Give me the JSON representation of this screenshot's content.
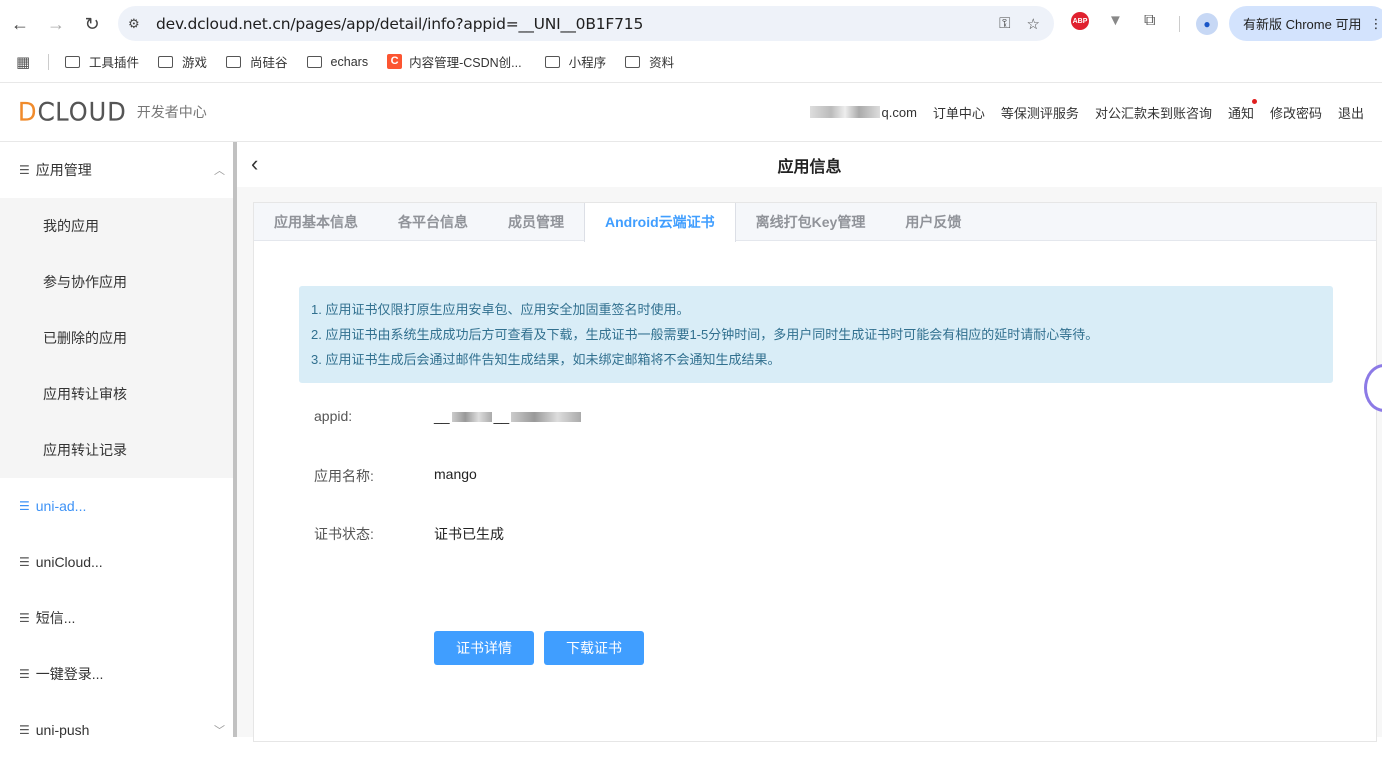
{
  "browser": {
    "url": "dev.dcloud.net.cn/pages/app/detail/info?appid=__UNI__0B1F715",
    "update_label": "有新版 Chrome 可用",
    "bookmarks": [
      {
        "label": "工具插件",
        "type": "folder"
      },
      {
        "label": "游戏",
        "type": "folder"
      },
      {
        "label": "尚硅谷",
        "type": "folder"
      },
      {
        "label": "echars",
        "type": "folder"
      },
      {
        "label": "内容管理-CSDN创...",
        "type": "csdn"
      },
      {
        "label": "小程序",
        "type": "folder"
      },
      {
        "label": "资料",
        "type": "folder"
      }
    ]
  },
  "header": {
    "logo_text": "DCLOUD",
    "subtitle": "开发者中心",
    "email_suffix": "q.com",
    "links": [
      "订单中心",
      "等保测评服务",
      "对公汇款未到账咨询",
      "通知",
      "修改密码",
      "退出"
    ]
  },
  "sidebar": {
    "group_app": "应用管理",
    "sub_items": [
      "我的应用",
      "参与协作应用",
      "已删除的应用",
      "应用转让审核",
      "应用转让记录"
    ],
    "groups": [
      "uni-ad...",
      "uniCloud...",
      "短信...",
      "一键登录...",
      "uni-push"
    ]
  },
  "main": {
    "title": "应用信息",
    "tabs": [
      "应用基本信息",
      "各平台信息",
      "成员管理",
      "Android云端证书",
      "离线打包Key管理",
      "用户反馈"
    ],
    "notices": [
      "1. 应用证书仅限打原生应用安卓包、应用安全加固重签名时使用。",
      "2. 应用证书由系统生成成功后方可查看及下载，生成证书一般需要1-5分钟时间，多用户同时生成证书时可能会有相应的延时请耐心等待。",
      "3. 应用证书生成后会通过邮件告知生成结果，如未绑定邮箱将不会通知生成结果。"
    ],
    "fields": {
      "appid_label": "appid:",
      "appid_prefix": "__",
      "name_label": "应用名称:",
      "name_value": "mango",
      "status_label": "证书状态:",
      "status_value": "证书已生成"
    },
    "buttons": {
      "detail": "证书详情",
      "download": "下载证书"
    }
  },
  "colors": {
    "accent": "#409eff",
    "notice_bg": "#d9edf7",
    "logo_orange": "#f08b2c"
  }
}
